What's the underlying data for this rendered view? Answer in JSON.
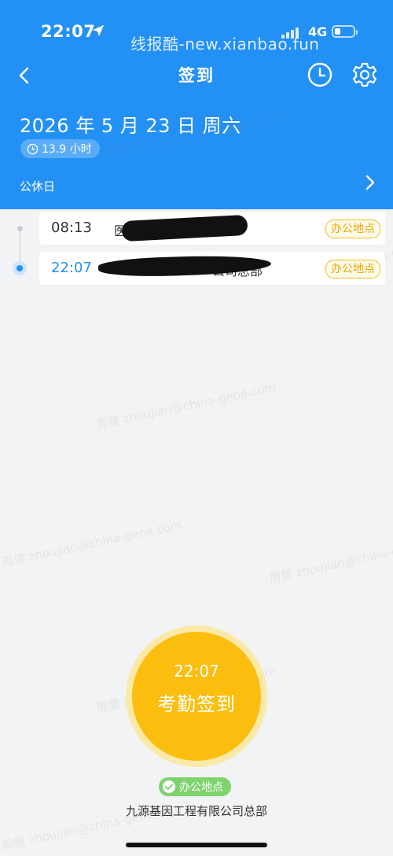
{
  "status_bar": {
    "time": "22:07",
    "watermark": "线报酷-new.xianbao.fun",
    "network": "4G"
  },
  "nav": {
    "title": "签到"
  },
  "header": {
    "date": "2026 年 5 月 23 日 周六",
    "work_hours": "13.9 小时",
    "day_type": "公休日"
  },
  "records": [
    {
      "time": "08:13",
      "place": "医",
      "tag": "办公地点"
    },
    {
      "time": "22:07",
      "place": "公司总部",
      "tag": "办公地点"
    }
  ],
  "punch": {
    "time": "22:07",
    "label": "考勤签到"
  },
  "location_status": "办公地点",
  "company": "九源基因工程有限公司总部",
  "watermarks": {
    "user": "周健 zhoujian@china-gene.com"
  },
  "colors": {
    "header_blue": "#2390f5",
    "punch_yellow": "#fbbe0f",
    "status_green": "#7ed36d",
    "tag_orange": "#f4b81c"
  }
}
